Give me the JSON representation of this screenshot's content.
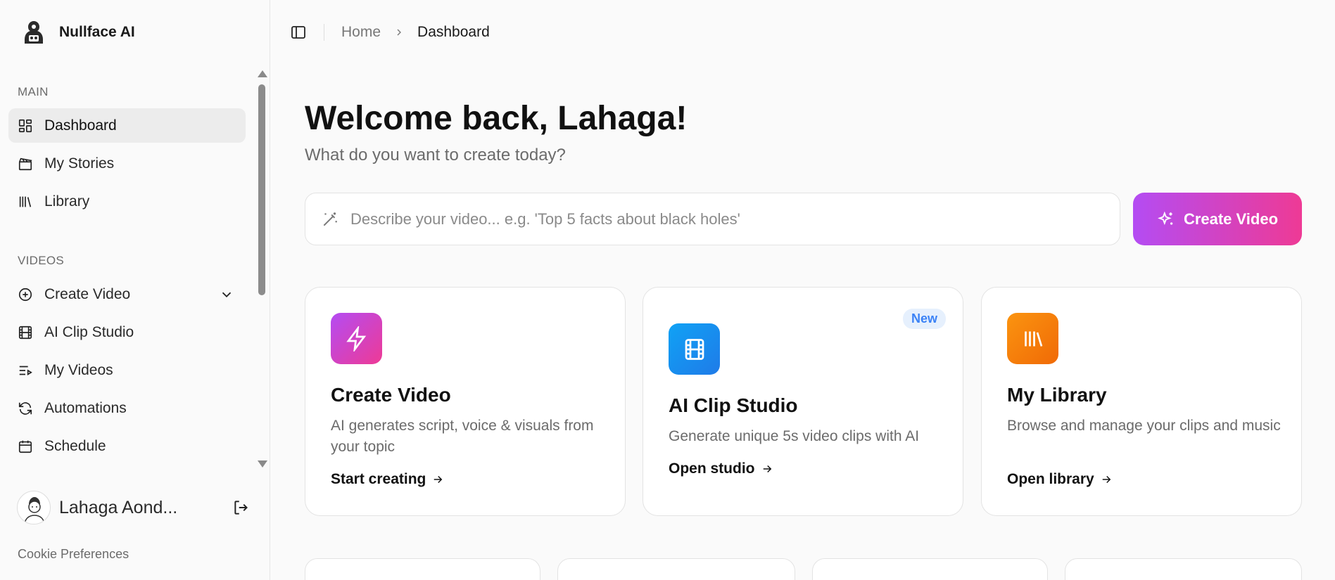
{
  "brand": {
    "name": "Nullface AI"
  },
  "sidebar": {
    "sections": [
      {
        "label": "MAIN"
      },
      {
        "label": "VIDEOS"
      }
    ],
    "main_items": [
      {
        "label": "Dashboard",
        "icon": "dashboard-icon",
        "active": true
      },
      {
        "label": "My Stories",
        "icon": "clapperboard-icon"
      },
      {
        "label": "Library",
        "icon": "library-icon"
      }
    ],
    "video_items": [
      {
        "label": "Create Video",
        "icon": "plus-circle-icon"
      },
      {
        "label": "AI Clip Studio",
        "icon": "film-icon"
      },
      {
        "label": "My Videos",
        "icon": "list-video-icon"
      },
      {
        "label": "Automations",
        "icon": "refresh-icon"
      },
      {
        "label": "Schedule",
        "icon": "calendar-icon"
      }
    ],
    "user": {
      "name": "Lahaga Aond..."
    },
    "cookie": "Cookie Preferences"
  },
  "topbar": {
    "breadcrumb": [
      "Home",
      "Dashboard"
    ]
  },
  "main": {
    "title": "Welcome back, Lahaga!",
    "subtitle": "What do you want to create today?",
    "prompt_placeholder": "Describe your video... e.g. 'Top 5 facts about black holes'",
    "create_button": "Create Video",
    "cards": [
      {
        "title": "Create Video",
        "desc": "AI generates script, voice & visuals from your topic",
        "link": "Start creating",
        "accent": "#c23df0"
      },
      {
        "title": "AI Clip Studio",
        "desc": "Generate unique 5s video clips with AI",
        "link": "Open studio",
        "badge": "New",
        "accent": "#1793f0"
      },
      {
        "title": "My Library",
        "desc": "Browse and manage your clips and music",
        "link": "Open library",
        "accent": "#f57a0a"
      }
    ]
  }
}
